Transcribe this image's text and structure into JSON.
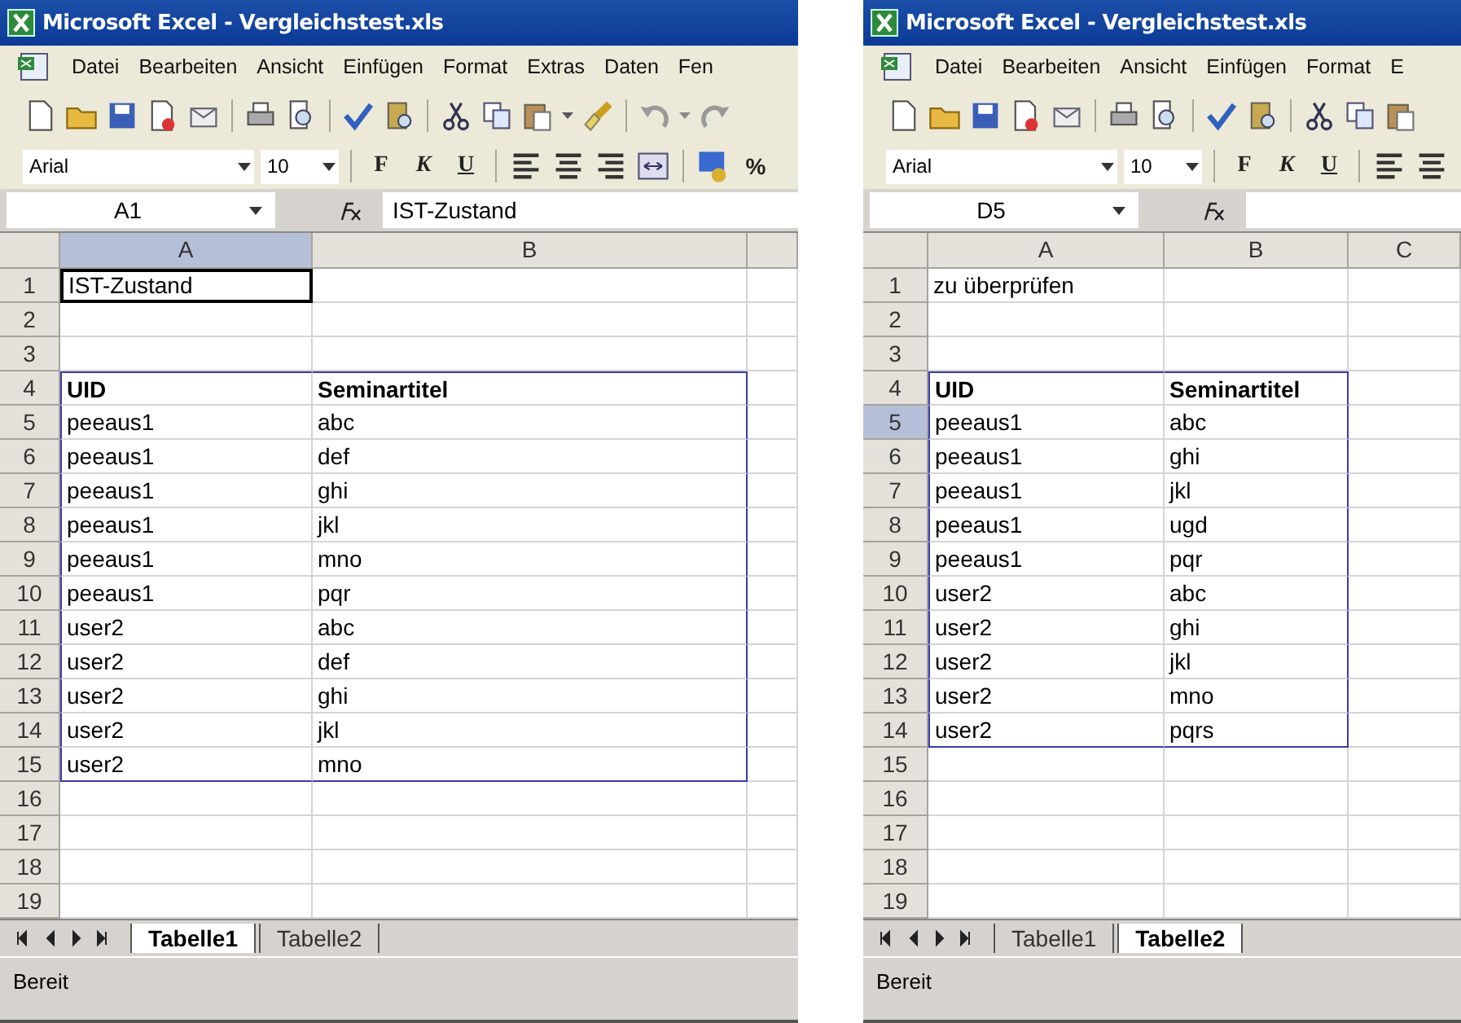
{
  "windows": [
    {
      "title": "Microsoft Excel - Vergleichstest.xls",
      "menu": [
        "Datei",
        "Bearbeiten",
        "Ansicht",
        "Einfügen",
        "Format",
        "Extras",
        "Daten",
        "Fen"
      ],
      "font": "Arial",
      "size": "10",
      "style_buttons": [
        "F",
        "K",
        "U"
      ],
      "percent": "%",
      "name_box": "A1",
      "formula": "IST-Zustand",
      "columns": [
        {
          "label": "A",
          "selected": true
        },
        {
          "label": "B",
          "selected": false
        }
      ],
      "rows": [
        {
          "number": "1",
          "selected": false,
          "framed": false,
          "bold": false,
          "cells": [
            {
              "text": "IST-Zustand",
              "active": true
            }
          ]
        },
        {
          "number": "2",
          "selected": false,
          "framed": false,
          "cells": []
        },
        {
          "number": "3",
          "selected": false,
          "framed": false,
          "cells": []
        },
        {
          "number": "4",
          "selected": false,
          "framed": true,
          "bold": true,
          "cells": [
            {
              "text": "UID",
              "active": false
            },
            {
              "text": "Seminartitel",
              "active": false
            }
          ]
        },
        {
          "number": "5",
          "selected": false,
          "framed": true,
          "bold": false,
          "cells": [
            {
              "text": "peeaus1",
              "active": false
            },
            {
              "text": "abc",
              "active": false
            }
          ]
        },
        {
          "number": "6",
          "selected": false,
          "framed": true,
          "bold": false,
          "cells": [
            {
              "text": "peeaus1",
              "active": false
            },
            {
              "text": "def",
              "active": false
            }
          ]
        },
        {
          "number": "7",
          "selected": false,
          "framed": true,
          "bold": false,
          "cells": [
            {
              "text": "peeaus1",
              "active": false
            },
            {
              "text": "ghi",
              "active": false
            }
          ]
        },
        {
          "number": "8",
          "selected": false,
          "framed": true,
          "bold": false,
          "cells": [
            {
              "text": "peeaus1",
              "active": false
            },
            {
              "text": "jkl",
              "active": false
            }
          ]
        },
        {
          "number": "9",
          "selected": false,
          "framed": true,
          "bold": false,
          "cells": [
            {
              "text": "peeaus1",
              "active": false
            },
            {
              "text": "mno",
              "active": false
            }
          ]
        },
        {
          "number": "10",
          "selected": false,
          "framed": true,
          "bold": false,
          "cells": [
            {
              "text": "peeaus1",
              "active": false
            },
            {
              "text": "pqr",
              "active": false
            }
          ]
        },
        {
          "number": "11",
          "selected": false,
          "framed": true,
          "bold": false,
          "cells": [
            {
              "text": "user2",
              "active": false
            },
            {
              "text": "abc",
              "active": false
            }
          ]
        },
        {
          "number": "12",
          "selected": false,
          "framed": true,
          "bold": false,
          "cells": [
            {
              "text": "user2",
              "active": false
            },
            {
              "text": "def",
              "active": false
            }
          ]
        },
        {
          "number": "13",
          "selected": false,
          "framed": true,
          "bold": false,
          "cells": [
            {
              "text": "user2",
              "active": false
            },
            {
              "text": "ghi",
              "active": false
            }
          ]
        },
        {
          "number": "14",
          "selected": false,
          "framed": true,
          "bold": false,
          "cells": [
            {
              "text": "user2",
              "active": false
            },
            {
              "text": "jkl",
              "active": false
            }
          ]
        },
        {
          "number": "15",
          "selected": false,
          "framed": true,
          "bold": false,
          "cells": [
            {
              "text": "user2",
              "active": false
            },
            {
              "text": "mno",
              "active": false
            }
          ]
        },
        {
          "number": "16",
          "selected": false,
          "framed": false,
          "cells": []
        },
        {
          "number": "17",
          "selected": false,
          "framed": false,
          "cells": []
        },
        {
          "number": "18",
          "selected": false,
          "framed": false,
          "cells": []
        },
        {
          "number": "19",
          "selected": false,
          "framed": false,
          "cells": []
        }
      ],
      "sheets": [
        {
          "label": "Tabelle1",
          "selected": true
        },
        {
          "label": "Tabelle2",
          "selected": false
        }
      ],
      "status": "Bereit"
    },
    {
      "title": "Microsoft Excel - Vergleichstest.xls",
      "menu": [
        "Datei",
        "Bearbeiten",
        "Ansicht",
        "Einfügen",
        "Format",
        "E"
      ],
      "font": "Arial",
      "size": "10",
      "style_buttons": [
        "F",
        "K",
        "U"
      ],
      "name_box": "D5",
      "columns": [
        {
          "label": "A",
          "selected": false
        },
        {
          "label": "B",
          "selected": false
        },
        {
          "label": "C",
          "selected": false
        }
      ],
      "rows": [
        {
          "number": "1",
          "selected": false,
          "framed": false,
          "bold": false,
          "cells": [
            {
              "text": "zu überprüfen",
              "active": false
            }
          ]
        },
        {
          "number": "2",
          "selected": false,
          "framed": false,
          "cells": []
        },
        {
          "number": "3",
          "selected": false,
          "framed": false,
          "cells": []
        },
        {
          "number": "4",
          "selected": false,
          "framed": true,
          "bold": true,
          "cells": [
            {
              "text": "UID",
              "active": false
            },
            {
              "text": "Seminartitel",
              "active": false
            }
          ]
        },
        {
          "number": "5",
          "selected": true,
          "framed": true,
          "bold": false,
          "cells": [
            {
              "text": "peeaus1",
              "active": false
            },
            {
              "text": "abc",
              "active": false
            }
          ]
        },
        {
          "number": "6",
          "selected": false,
          "framed": true,
          "bold": false,
          "cells": [
            {
              "text": "peeaus1",
              "active": false
            },
            {
              "text": "ghi",
              "active": false
            }
          ]
        },
        {
          "number": "7",
          "selected": false,
          "framed": true,
          "bold": false,
          "cells": [
            {
              "text": "peeaus1",
              "active": false
            },
            {
              "text": "jkl",
              "active": false
            }
          ]
        },
        {
          "number": "8",
          "selected": false,
          "framed": true,
          "bold": false,
          "cells": [
            {
              "text": "peeaus1",
              "active": false
            },
            {
              "text": "ugd",
              "active": false
            }
          ]
        },
        {
          "number": "9",
          "selected": false,
          "framed": true,
          "bold": false,
          "cells": [
            {
              "text": "peeaus1",
              "active": false
            },
            {
              "text": "pqr",
              "active": false
            }
          ]
        },
        {
          "number": "10",
          "selected": false,
          "framed": true,
          "bold": false,
          "cells": [
            {
              "text": "user2",
              "active": false
            },
            {
              "text": "abc",
              "active": false
            }
          ]
        },
        {
          "number": "11",
          "selected": false,
          "framed": true,
          "bold": false,
          "cells": [
            {
              "text": "user2",
              "active": false
            },
            {
              "text": "ghi",
              "active": false
            }
          ]
        },
        {
          "number": "12",
          "selected": false,
          "framed": true,
          "bold": false,
          "cells": [
            {
              "text": "user2",
              "active": false
            },
            {
              "text": "jkl",
              "active": false
            }
          ]
        },
        {
          "number": "13",
          "selected": false,
          "framed": true,
          "bold": false,
          "cells": [
            {
              "text": "user2",
              "active": false
            },
            {
              "text": "mno",
              "active": false
            }
          ]
        },
        {
          "number": "14",
          "selected": false,
          "framed": true,
          "bold": false,
          "cells": [
            {
              "text": "user2",
              "active": false
            },
            {
              "text": "pqrs",
              "active": false
            }
          ]
        },
        {
          "number": "15",
          "selected": false,
          "framed": false,
          "cells": []
        },
        {
          "number": "16",
          "selected": false,
          "framed": false,
          "cells": []
        },
        {
          "number": "17",
          "selected": false,
          "framed": false,
          "cells": []
        },
        {
          "number": "18",
          "selected": false,
          "framed": false,
          "cells": []
        },
        {
          "number": "19",
          "selected": false,
          "framed": false,
          "cells": []
        }
      ],
      "sheets": [
        {
          "label": "Tabelle1",
          "selected": false
        },
        {
          "label": "Tabelle2",
          "selected": true
        }
      ],
      "status": "Bereit"
    }
  ]
}
